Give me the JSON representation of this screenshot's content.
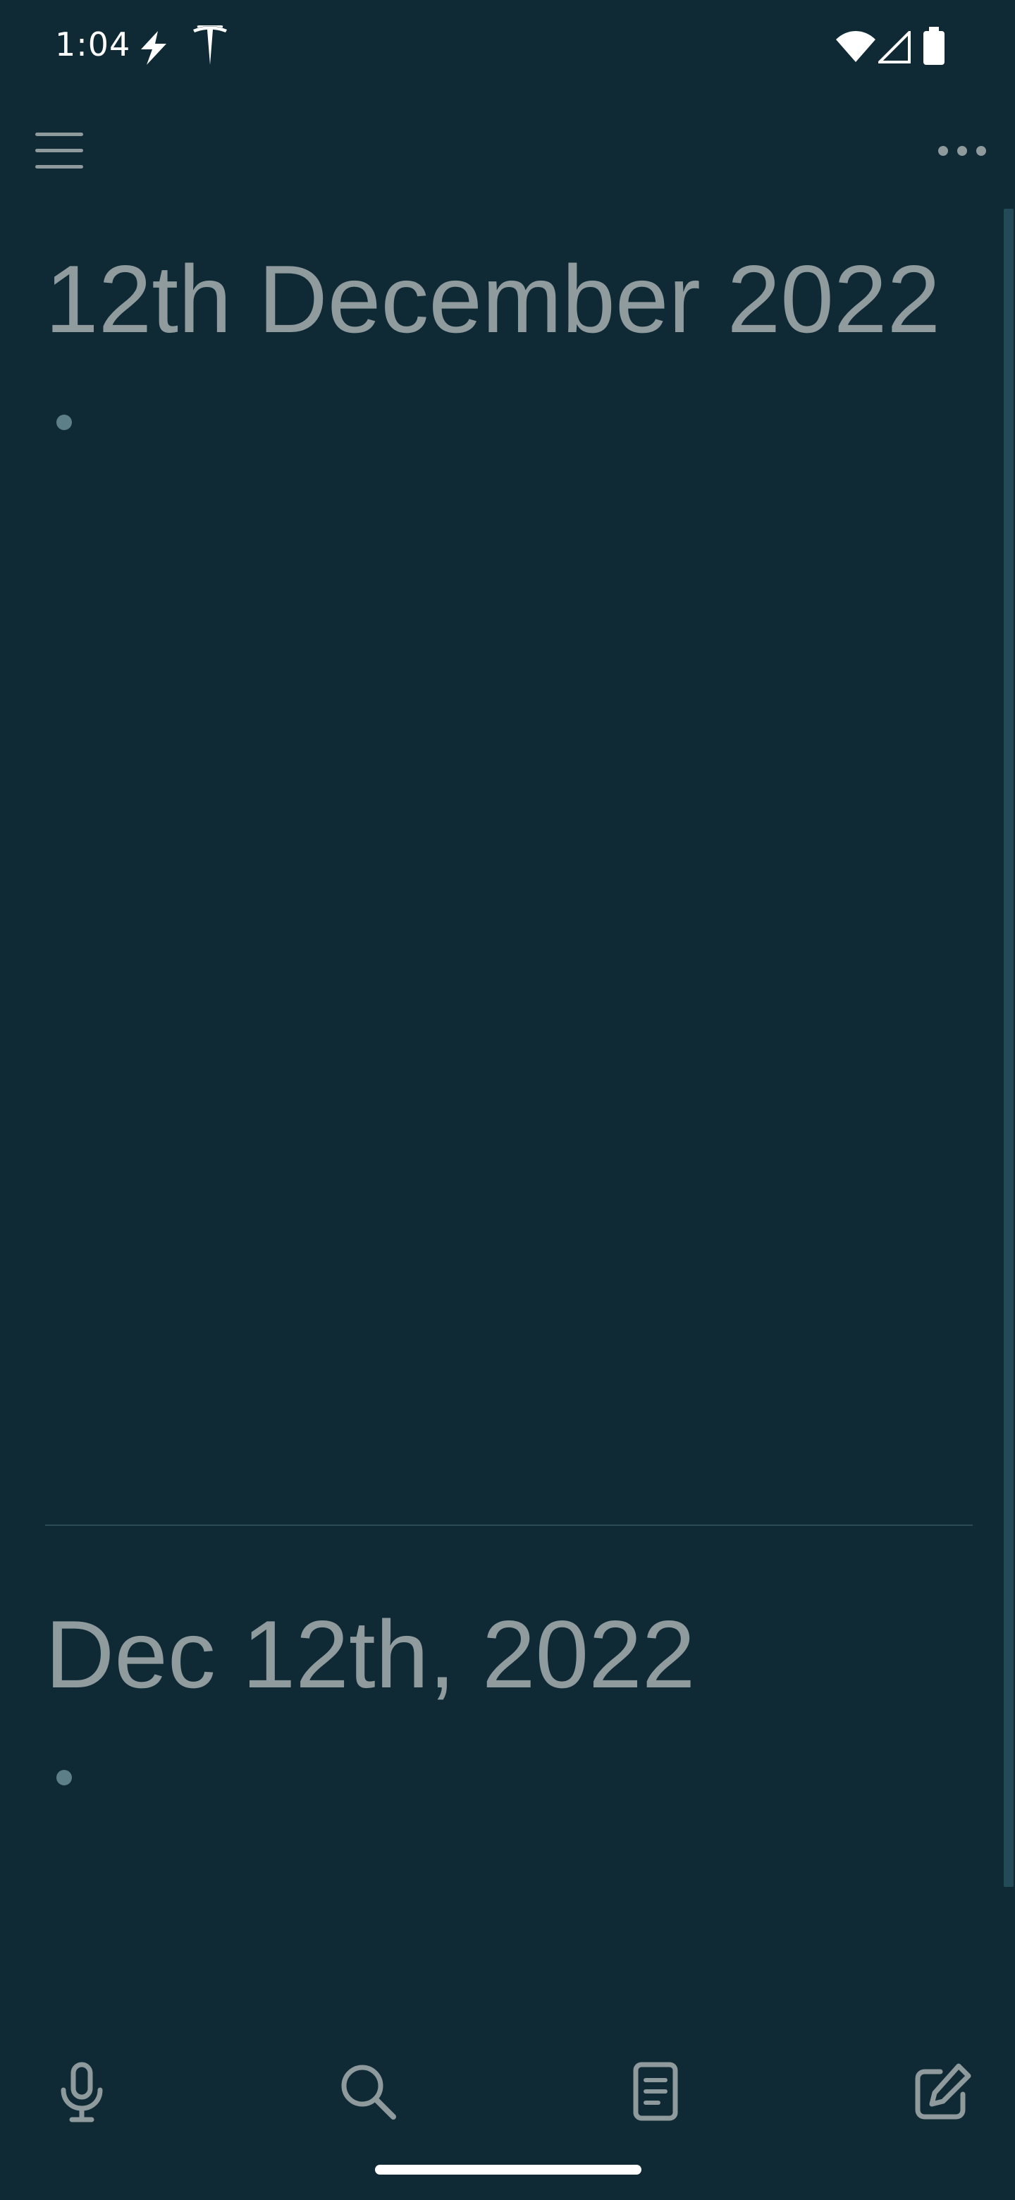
{
  "status_bar": {
    "time": "1:04",
    "icons": [
      "bolt-icon",
      "tesla-icon",
      "wifi-icon",
      "signal-icon",
      "battery-icon"
    ]
  },
  "toolbar": {
    "menu_icon": "hamburger-menu-icon",
    "more_icon": "more-horizontal-icon"
  },
  "journals": [
    {
      "title": "12th December 2022"
    },
    {
      "title": "Dec 12th, 2022"
    }
  ],
  "bottom_bar": {
    "icons": [
      "microphone-icon",
      "search-icon",
      "page-icon",
      "edit-icon"
    ]
  },
  "colors": {
    "background": "#0f2a35",
    "title_text": "#8f9b9d",
    "bullet": "#5d7f87",
    "icon": "#8e9a9c",
    "divider": "#2b4b55",
    "scroll_thumb": "#234b57"
  }
}
